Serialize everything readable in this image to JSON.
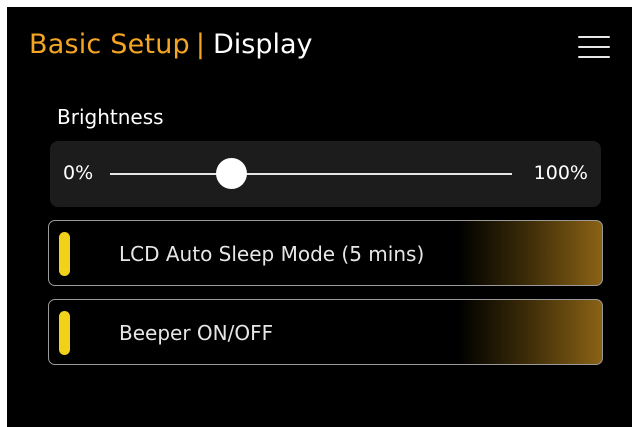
{
  "header": {
    "section_title": "Basic Setup",
    "separator": "|",
    "page_title": "Display",
    "accent_color": "#f5a524"
  },
  "menu": {
    "icon": "hamburger-menu-icon"
  },
  "brightness": {
    "label": "Brightness",
    "min_label": "0%",
    "max_label": "100%",
    "value_fraction": 0.3
  },
  "toggles": [
    {
      "label": "LCD Auto Sleep Mode (5 mins)",
      "indicator_color": "#f2d11b"
    },
    {
      "label": "Beeper ON/OFF",
      "indicator_color": "#f2d11b"
    }
  ]
}
